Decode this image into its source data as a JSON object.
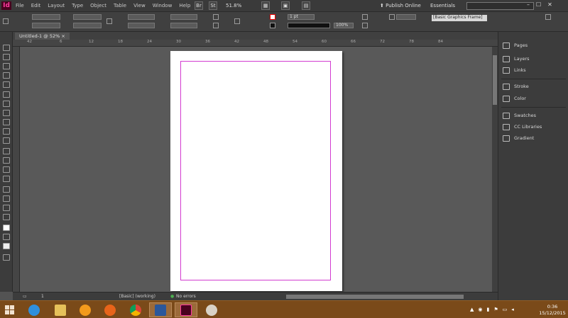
{
  "app": {
    "logo": "Id",
    "menus": [
      "File",
      "Edit",
      "Layout",
      "Type",
      "Object",
      "Table",
      "View",
      "Window",
      "Help"
    ],
    "zoom": "51.8%",
    "publish_online": "Publish Online",
    "workspace": "Essentials",
    "window_controls": [
      "–",
      "☐",
      "✕"
    ]
  },
  "control": {
    "stroke_weight": "1 pt",
    "opacity": "100%",
    "object_style": "[Basic Graphics Frame]"
  },
  "document": {
    "tab": "Untitled-1 @ 52%"
  },
  "ruler": {
    "labels": [
      "42",
      "6",
      "12",
      "18",
      "24",
      "30",
      "36",
      "42",
      "48",
      "54",
      "60",
      "66",
      "72",
      "78",
      "84"
    ]
  },
  "status": {
    "page": "1",
    "style": "[Basic] (working)",
    "errors": "No errors"
  },
  "panels": {
    "items": [
      "Pages",
      "Layers",
      "Links",
      "Stroke",
      "Color",
      "Swatches",
      "CC Libraries",
      "Gradient"
    ]
  },
  "taskbar": {
    "clock_time": "0:36",
    "clock_date": "15/12/2015"
  },
  "colors": {
    "accent": "#ff3aa0",
    "margin_guide": "#d23bd0",
    "taskbar": "#7a4a19"
  }
}
